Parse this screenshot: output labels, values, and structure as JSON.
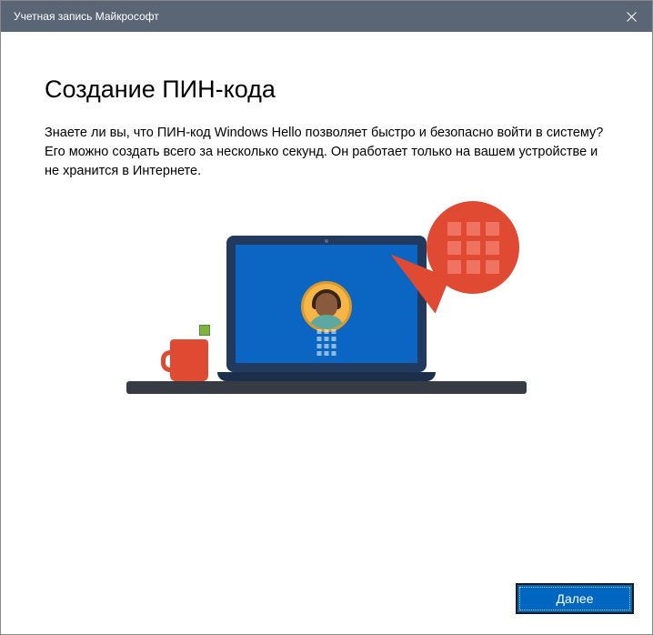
{
  "titlebar": {
    "title": "Учетная запись Майкрософт"
  },
  "main": {
    "heading": "Создание ПИН-кода",
    "description": "Знаете ли вы, что ПИН-код Windows Hello позволяет быстро и безопасно войти в систему? Его можно создать всего за несколько секунд. Он работает только на вашем устройстве и не хранится в Интернете."
  },
  "footer": {
    "next_label": "Далее"
  }
}
